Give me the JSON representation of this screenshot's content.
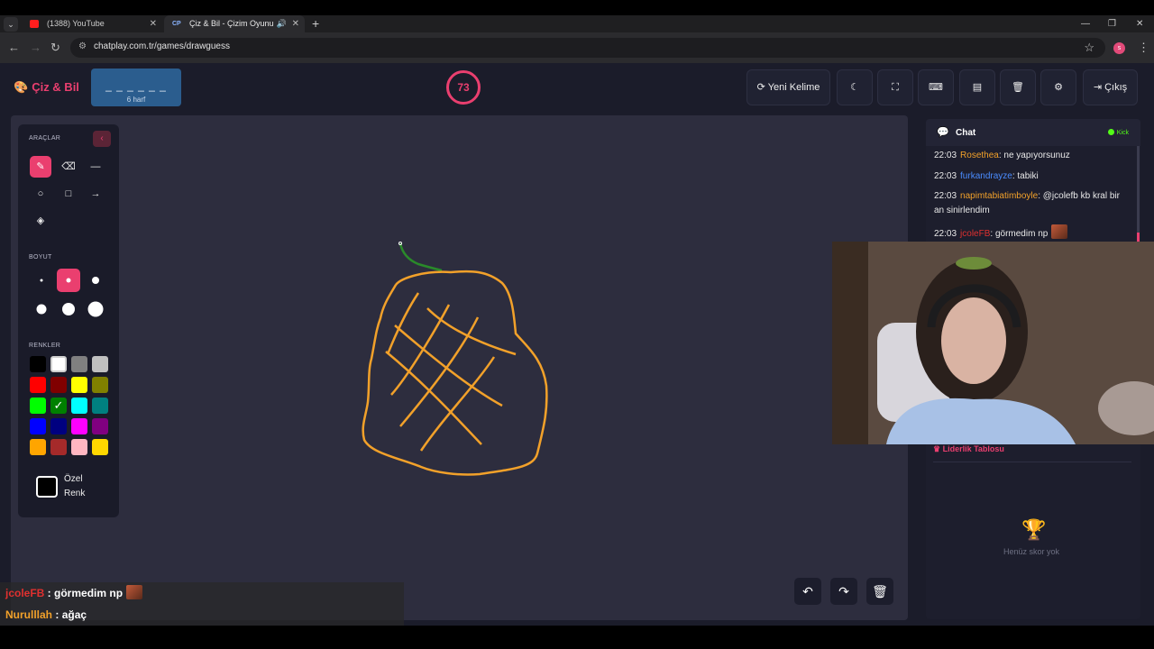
{
  "browser": {
    "tabs": [
      {
        "title": "(1388) YouTube",
        "favicon": "youtube-icon",
        "active": false
      },
      {
        "title": "Çiz & Bil - Çizim Oyunu",
        "favicon": "CP",
        "active": true
      }
    ],
    "url": "chatplay.com.tr/games/drawguess",
    "profile_initial": "s"
  },
  "app": {
    "logo": "Çiz & Bil",
    "word": {
      "blanks": "_ _ _ _ _ _",
      "hint": "6 harf"
    },
    "timer": "73",
    "buttons": {
      "new_word": "Yeni Kelime",
      "exit": "Çıkış"
    },
    "accent_color": "#ea3f6f"
  },
  "toolbox": {
    "tools_label": "ARAÇLAR",
    "size_label": "BOYUT",
    "colors_label": "RENKLER",
    "custom_color_label_1": "Özel",
    "custom_color_label_2": "Renk",
    "tools": [
      "brush-icon",
      "eraser-icon",
      "line-icon",
      "circle-icon",
      "rectangle-icon",
      "arrow-icon",
      "fill-bucket-icon"
    ],
    "active_tool": "brush-icon",
    "active_size_index": 1,
    "palette": [
      "#000000",
      "#ffffff",
      "#808080",
      "#c0c0c0",
      "#ff0000",
      "#800000",
      "#ffff00",
      "#808000",
      "#00ff00",
      "#008000",
      "#00ffff",
      "#008080",
      "#0000ff",
      "#000080",
      "#ff00ff",
      "#800080",
      "#ffa500",
      "#a52a2a",
      "#ffb6c1",
      "#ffd700"
    ],
    "selected_color": "#008000"
  },
  "chat": {
    "title": "Chat",
    "platform": "Kick",
    "messages": [
      {
        "time": "22:03",
        "user": "Rosethea",
        "color": "#f2a12a",
        "text": "ne yapıyorsunuz"
      },
      {
        "time": "22:03",
        "user": "furkandrayze",
        "color": "#4a8cff",
        "text": "tabiki"
      },
      {
        "time": "22:03",
        "user": "napimtabiatimboyle",
        "color": "#f2a12a",
        "text": "@jcolefb kb kral bir an sinirlendim"
      },
      {
        "time": "22:03",
        "user": "jcoleFB",
        "color": "#e0302f",
        "text": "görmedim np"
      }
    ]
  },
  "leaderboard": {
    "title": "Liderlik Tablosu",
    "empty": "Henüz skor yok"
  },
  "overlay": [
    {
      "user": "jcoleFB",
      "text": "görmedim np"
    },
    {
      "user": "Nurulllah",
      "text": "ağaç"
    }
  ]
}
